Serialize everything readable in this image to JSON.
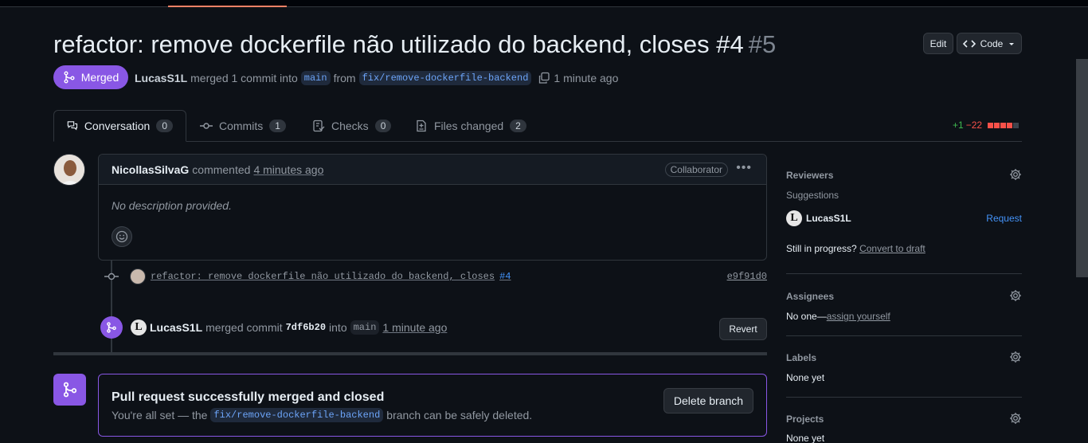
{
  "pr": {
    "title": "refactor: remove dockerfile não utilizado do backend, closes #4",
    "number": "#5",
    "status_label": "Merged",
    "author": "LucasS1L",
    "meta_text": "merged 1 commit into",
    "base_branch": "main",
    "from_text": "from",
    "head_branch": "fix/remove-dockerfile-backend",
    "time": "1 minute ago"
  },
  "header_actions": {
    "edit_label": "Edit",
    "code_label": "Code"
  },
  "tabs": [
    {
      "label": "Conversation",
      "count": "0"
    },
    {
      "label": "Commits",
      "count": "1"
    },
    {
      "label": "Checks",
      "count": "0"
    },
    {
      "label": "Files changed",
      "count": "2"
    }
  ],
  "diffstat": {
    "additions": "+1",
    "deletions": "−22"
  },
  "comment": {
    "author": "NicollasSilvaG",
    "action": "commented",
    "time": "4 minutes ago",
    "role": "Collaborator",
    "body": "No description provided."
  },
  "commit": {
    "message": "refactor: remove dockerfile não utilizado do backend, closes",
    "issue_ref": "#4",
    "sha": "e9f91d0"
  },
  "merge_event": {
    "author": "LucasS1L",
    "text": "merged commit",
    "sha": "7df6b20",
    "into": "into",
    "branch": "main",
    "time": "1 minute ago",
    "revert_label": "Revert"
  },
  "merge_status": {
    "title": "Pull request successfully merged and closed",
    "sub_prefix": "You're all set — the",
    "branch": "fix/remove-dockerfile-backend",
    "sub_suffix": "branch can be safely deleted.",
    "delete_label": "Delete branch"
  },
  "sidebar": {
    "reviewers": {
      "heading": "Reviewers",
      "suggestions": "Suggestions",
      "user": "LucasS1L",
      "request": "Request",
      "draft_prefix": "Still in progress?",
      "draft_link": "Convert to draft"
    },
    "assignees": {
      "heading": "Assignees",
      "none": "No one—",
      "link": "assign yourself"
    },
    "labels": {
      "heading": "Labels",
      "value": "None yet"
    },
    "projects": {
      "heading": "Projects",
      "value": "None yet"
    }
  },
  "colors": {
    "merged": "#8957e5",
    "addition": "#3fb950",
    "deletion": "#f85149",
    "link": "#4493f8"
  }
}
